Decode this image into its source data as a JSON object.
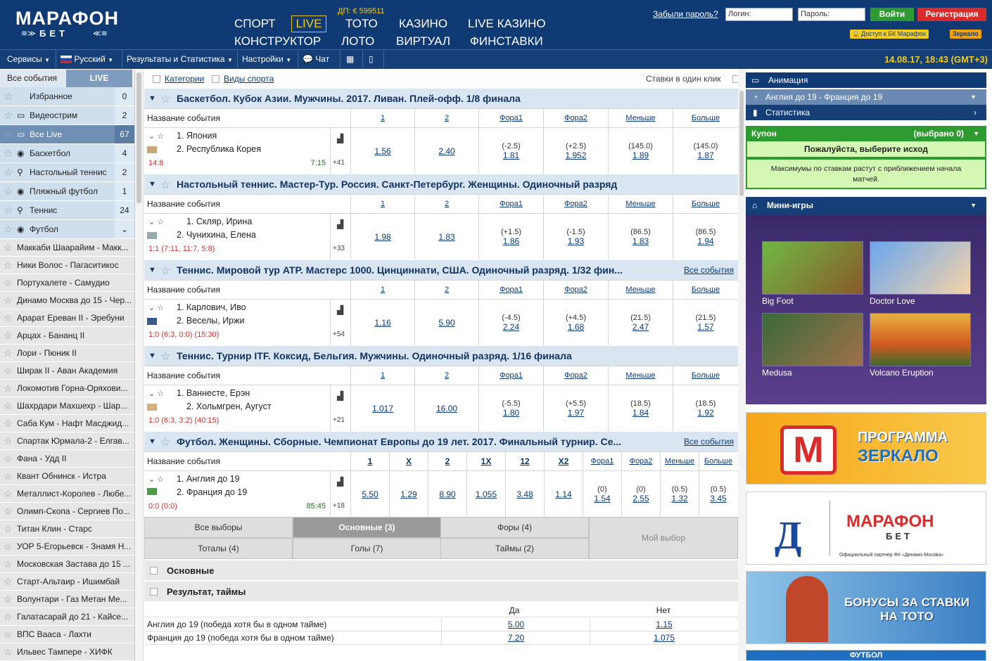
{
  "header": {
    "logo_top": "МАРАФОН",
    "logo_bottom": "БЕТ",
    "dp": "ДП: € 599511",
    "nav": [
      "СПОРТ",
      "LIVE",
      "ТОТО",
      "КАЗИНО",
      "LIVE КАЗИНО",
      "КОНСТРУКТОР",
      "ЛОТО",
      "ВИРТУАЛ",
      "ФИНСТАВКИ"
    ],
    "forgot": "Забыли пароль?",
    "login_placeholder": "Логин:",
    "password_placeholder": "Пароль:",
    "login_btn": "Войти",
    "register_btn": "Регистрация",
    "access": "Доступ к БК Марафон",
    "mirror": "Зеркало"
  },
  "menubar": {
    "items": [
      "Сервисы",
      "Русский",
      "Результаты и Статистика",
      "Настройки",
      "Чат"
    ],
    "clock": "14.08.17, 18:43 (GMT+3)"
  },
  "sidebar": {
    "tab_all": "Все события",
    "tab_live": "LIVE",
    "cats": [
      {
        "label": "Избранное",
        "count": "0"
      },
      {
        "label": "Видеострим",
        "count": "2"
      },
      {
        "label": "Все Live",
        "count": "67"
      },
      {
        "label": "Баскетбол",
        "count": "4"
      },
      {
        "label": "Настольный теннис",
        "count": "2"
      },
      {
        "label": "Пляжный футбол",
        "count": "1"
      },
      {
        "label": "Теннис",
        "count": "24"
      },
      {
        "label": "Футбол",
        "count": ""
      }
    ],
    "events": [
      "Маккаби Шаарайим - Макк...",
      "Ники Волос - Пагаситикос",
      "Портухалете - Самудио",
      "Динамо Москва до 15 - Чер...",
      "Арарат Ереван II - Эребуни",
      "Арцах - Бананц II",
      "Лори - Пюник II",
      "Ширак II - Аван Академия",
      "Локомотив Горна-Оряхови...",
      "Шахрдари Махшехр - Шар...",
      "Саба Кум - Нафт Масджид...",
      "Спартак Юрмала-2 - Елгав...",
      "Фана - Удд II",
      "Квант Обнинск - Истра",
      "Металлист-Королев - Любе...",
      "Олимп-Скопа - Сергиев По...",
      "Титан Клин - Старс",
      "УОР 5-Егорьевск - Знамя Н...",
      "Московская Застава до 15 ...",
      "Старт-Альтаир - Ишимбай",
      "Волунтари - Газ Метан Ме...",
      "Галатасарай до 21 - Кайсе...",
      "ВПС Вааса - Лахти",
      "Ильвес Тампере - ХИФК"
    ]
  },
  "filters": {
    "categories": "Категории",
    "sports": "Виды спорта",
    "oneclick": "Ставки в один клик"
  },
  "event_name_header": "Название события",
  "std_cols": [
    "1",
    "2",
    "Фора1",
    "Фора2",
    "Меньше",
    "Больше"
  ],
  "groups": [
    {
      "title": "Баскетбол. Кубок Азии. Мужчины. 2017. Ливан. Плей-офф. 1/8 финала",
      "all": "",
      "t1": "1. Япония",
      "t2": "2. Республика Корея",
      "score": "14:8",
      "time": "7:15",
      "more": "+41",
      "odds": [
        {
          "h": "",
          "v": "1.56"
        },
        {
          "h": "",
          "v": "2.40"
        },
        {
          "h": "(-2.5)",
          "v": "1.81"
        },
        {
          "h": "(+2.5)",
          "v": "1.952"
        },
        {
          "h": "(145.0)",
          "v": "1.89"
        },
        {
          "h": "(145.0)",
          "v": "1.87"
        }
      ]
    },
    {
      "title": "Настольный теннис. Мастер-Тур. Россия. Санкт-Петербург. Женщины. Одиночный разряд",
      "all": "",
      "t1": "1. Скляр, Ирина",
      "t2": "2. Чунихина, Елена",
      "score": "1:1 (7:11, 11:7, 5:8)",
      "time": "",
      "more": "+33",
      "odds": [
        {
          "h": "",
          "v": "1.98"
        },
        {
          "h": "",
          "v": "1.83"
        },
        {
          "h": "(+1.5)",
          "v": "1.86"
        },
        {
          "h": "(-1.5)",
          "v": "1.93"
        },
        {
          "h": "(86.5)",
          "v": "1.83"
        },
        {
          "h": "(86.5)",
          "v": "1.94"
        }
      ]
    },
    {
      "title": "Теннис. Мировой тур ATP. Мастерс 1000. Цинциннати, США. Одиночный разряд. 1/32 фин...",
      "all": "Все события",
      "t1": "1. Карлович, Иво",
      "t2": "2. Веселы, Иржи",
      "score": "1:0 (6:3, 0:0) (15:30)",
      "time": "",
      "more": "+54",
      "odds": [
        {
          "h": "",
          "v": "1.16"
        },
        {
          "h": "",
          "v": "5.90"
        },
        {
          "h": "(-4.5)",
          "v": "2.24"
        },
        {
          "h": "(+4.5)",
          "v": "1.68"
        },
        {
          "h": "(21.5)",
          "v": "2.47"
        },
        {
          "h": "(21.5)",
          "v": "1.57"
        }
      ]
    },
    {
      "title": "Теннис. Турнир ITF. Коксид, Бельгия. Мужчины. Одиночный разряд. 1/16 финала",
      "all": "",
      "t1": "1. Ваннесте, Ерэн",
      "t2": "2. Хольмгрен, Аугуст",
      "score": "1:0 (6:3, 3:2) (40:15)",
      "time": "",
      "more": "+21",
      "odds": [
        {
          "h": "",
          "v": "1.017"
        },
        {
          "h": "",
          "v": "16.00"
        },
        {
          "h": "(-5.5)",
          "v": "1.80"
        },
        {
          "h": "(+5.5)",
          "v": "1.97"
        },
        {
          "h": "(18.5)",
          "v": "1.84"
        },
        {
          "h": "(18.5)",
          "v": "1.92"
        }
      ]
    }
  ],
  "football": {
    "title": "Футбол. Женщины. Сборные. Чемпионат Европы до 19 лет. 2017. Финальный турнир. Се...",
    "all": "Все события",
    "cols": [
      "1",
      "X",
      "2",
      "1X",
      "12",
      "X2",
      "Фора1",
      "Фора2",
      "Меньше",
      "Больше"
    ],
    "t1": "1. Англия до 19",
    "t2": "2. Франция до 19",
    "score": "0:0 (0:0)",
    "time": "85:45",
    "more": "+18",
    "odds": [
      {
        "h": "",
        "v": "5.50"
      },
      {
        "h": "",
        "v": "1.29"
      },
      {
        "h": "",
        "v": "8.90"
      },
      {
        "h": "",
        "v": "1.055"
      },
      {
        "h": "",
        "v": "3.48"
      },
      {
        "h": "",
        "v": "1.14"
      },
      {
        "h": "(0)",
        "v": "1.54"
      },
      {
        "h": "(0)",
        "v": "2.55"
      },
      {
        "h": "(0.5)",
        "v": "1.32"
      },
      {
        "h": "(0.5)",
        "v": "3.45"
      }
    ]
  },
  "bet_tabs": [
    "Все выборы",
    "Основные (3)",
    "Форы (4)",
    "Тоталы (4)",
    "Голы (7)",
    "Таймы (2)"
  ],
  "my_choice": "Мой выбор",
  "sections": [
    "Основные",
    "Результат, таймы"
  ],
  "yesno": {
    "yes": "Да",
    "no": "Нет",
    "rows": [
      {
        "label": "Англия до 19 (победа хотя бы в одном тайме)",
        "yes": "5.00",
        "no": "1.15"
      },
      {
        "label": "Франция до 19 (победа хотя бы в одном тайме)",
        "yes": "7.20",
        "no": "1.075"
      }
    ]
  },
  "right": {
    "animation": "Анимация",
    "match": "Англия до 19 - Франция до 19",
    "stats": "Статистика",
    "coupon": "Купон",
    "selected": "(выбрано 0)",
    "pick": "Пожалуйста, выберите исход",
    "max": "Максимумы по ставкам растут с приближением начала матчей.",
    "minigames": "Мини-игры",
    "games": [
      "Big Foot",
      "Doctor Love",
      "Medusa",
      "Volcano Eruption"
    ],
    "ad1_line1": "ПРОГРАММА",
    "ad1_line2": "ЗЕРКАЛО",
    "ad2_brand": "МАРАФОН",
    "ad2_sub": "БЕТ",
    "ad2_note": "Официальный партнер ФК «Динамо-Москва»",
    "ad3_line1": "БОНУСЫ ЗА СТАВКИ",
    "ad3_line2": "НА ТОТО",
    "ad4": "ФУТБОЛ"
  }
}
